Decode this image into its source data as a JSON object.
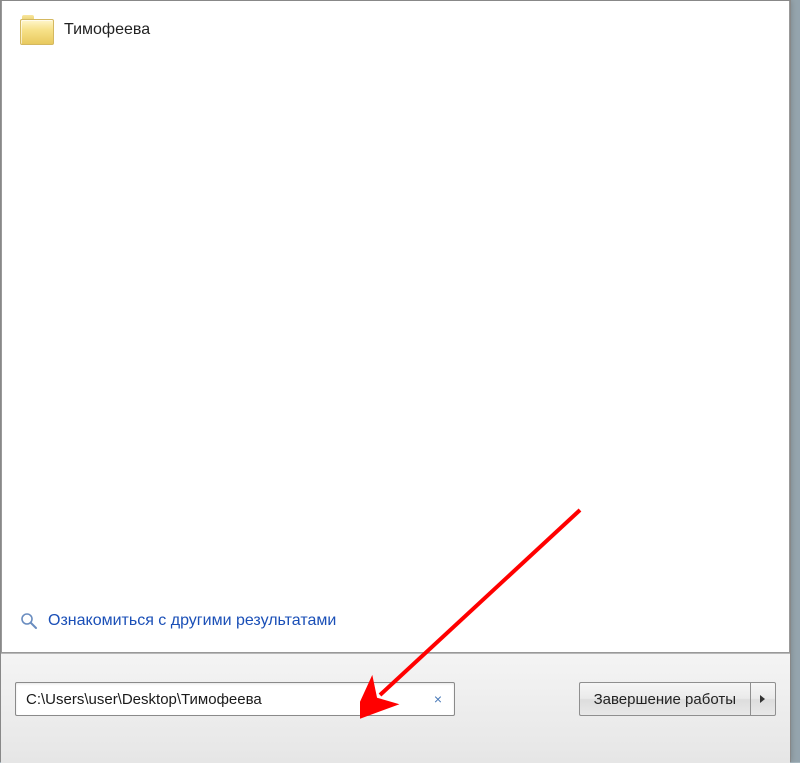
{
  "result": {
    "label": "Тимофеева",
    "icon": "folder-icon"
  },
  "more_results": {
    "label": "Ознакомиться с другими результатами",
    "icon": "magnifier-icon"
  },
  "search": {
    "value": "C:\\Users\\user\\Desktop\\Тимофеева",
    "clear_symbol": "×"
  },
  "shutdown": {
    "label": "Завершение работы"
  },
  "annotation": {
    "type": "arrow",
    "color": "#ff0000"
  }
}
